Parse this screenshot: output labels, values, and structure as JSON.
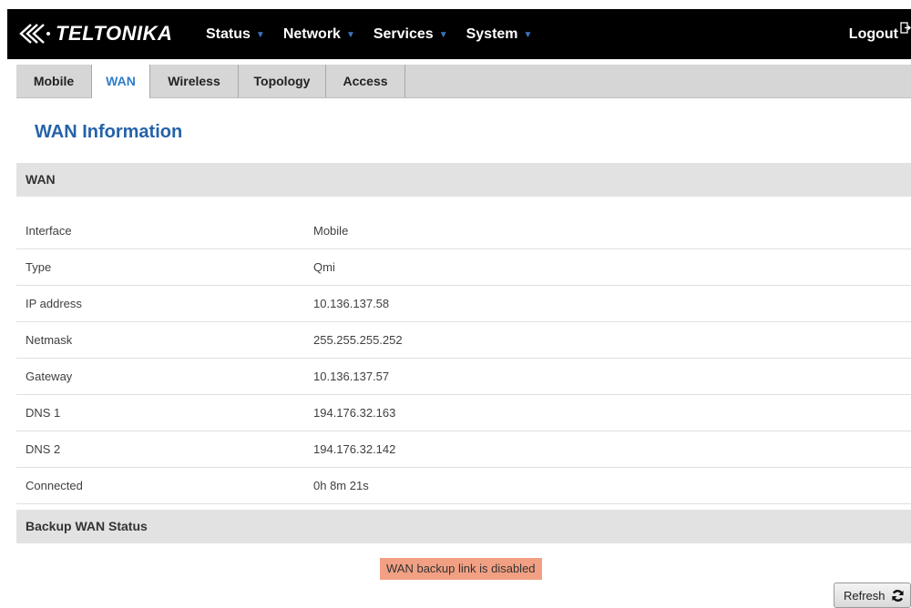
{
  "brand": {
    "name": "TELTONIKA"
  },
  "menu": [
    {
      "label": "Status"
    },
    {
      "label": "Network"
    },
    {
      "label": "Services"
    },
    {
      "label": "System"
    }
  ],
  "logout_label": "Logout",
  "tabs": [
    {
      "label": "Mobile",
      "active": false
    },
    {
      "label": "WAN",
      "active": true
    },
    {
      "label": "Wireless",
      "active": false
    },
    {
      "label": "Topology",
      "active": false
    },
    {
      "label": "Access",
      "active": false
    }
  ],
  "page_title": "WAN Information",
  "wan_section": {
    "title": "WAN",
    "rows": [
      {
        "key": "Interface",
        "value": "Mobile"
      },
      {
        "key": "Type",
        "value": "Qmi"
      },
      {
        "key": "IP address",
        "value": "10.136.137.58"
      },
      {
        "key": "Netmask",
        "value": "255.255.255.252"
      },
      {
        "key": "Gateway",
        "value": "10.136.137.57"
      },
      {
        "key": "DNS 1",
        "value": "194.176.32.163"
      },
      {
        "key": "DNS 2",
        "value": "194.176.32.142"
      },
      {
        "key": "Connected",
        "value": "0h 8m 21s"
      }
    ]
  },
  "backup_section": {
    "title": "Backup WAN Status",
    "notice": "WAN backup link is disabled"
  },
  "refresh_label": "Refresh",
  "colors": {
    "topbar": "#000000",
    "accent": "#2563a8",
    "active_tab": "#2f7dc8",
    "caret": "#3c76c4",
    "notice_bg": "#f2a083"
  }
}
